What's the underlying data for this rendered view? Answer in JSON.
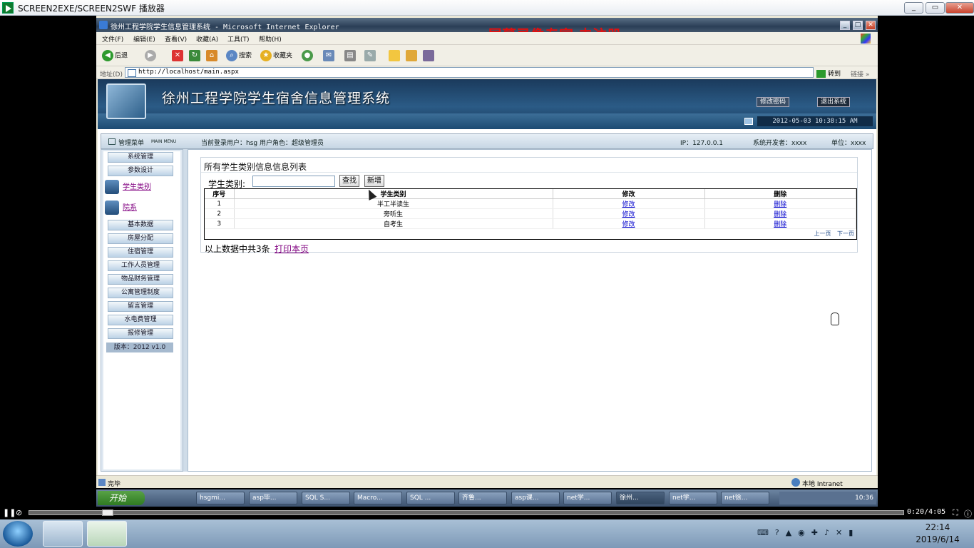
{
  "player": {
    "title": "SCREEN2EXE/SCREEN2SWF 播放器",
    "min": "_",
    "restore": "▭",
    "close": "✕",
    "time": "0:20/4:05"
  },
  "ie": {
    "title": "徐州工程学院学生信息管理系统 - Microsoft Internet Explorer",
    "watermark": "屏幕录像专家  未注册",
    "menu": [
      "文件(F)",
      "编辑(E)",
      "查看(V)",
      "收藏(A)",
      "工具(T)",
      "帮助(H)"
    ],
    "toolbar": {
      "back": "后退",
      "search": "搜索",
      "favorites": "收藏夹"
    },
    "address_label": "地址(D)",
    "address": "http://localhost/main.aspx",
    "go": "转到",
    "links": "链接 »",
    "status_left": "完毕",
    "status_right": "本地 Intranet"
  },
  "app": {
    "title": "徐州工程学院学生宿舍信息管理系统",
    "change_password": "修改密码",
    "logout": "退出系统",
    "datetime": "2012-05-03 10:38:15 AM",
    "menu_header": "管理菜单",
    "menu_header_en": "MAIN MENU",
    "current_user": "当前登录用户：hsg  用户角色：超级管理员",
    "ip": "IP：127.0.0.1",
    "developer": "系统开发者：xxxx",
    "unit": "单位：xxxx",
    "sidebar": {
      "top_buttons": [
        "系统管理",
        "参数设计"
      ],
      "links": [
        "学生类别",
        "院系"
      ],
      "buttons": [
        "基本数据",
        "房屋分配",
        "住宿管理",
        "工作人员管理",
        "物品财务管理",
        "公寓管理制度",
        "留言管理",
        "水电费管理",
        "报修管理"
      ],
      "version": "版本：2012 v1.0"
    },
    "panel": {
      "title": "所有学生类别信息信息列表",
      "filter_label": "学生类别:",
      "search_btn": "查找",
      "add_btn": "新增",
      "headers": [
        "序号",
        "学生类别",
        "修改",
        "删除"
      ],
      "rows": [
        {
          "no": "1",
          "name": "半工半读生",
          "edit": "修改",
          "del": "删除"
        },
        {
          "no": "2",
          "name": "旁听生",
          "edit": "修改",
          "del": "删除"
        },
        {
          "no": "3",
          "name": "自考生",
          "edit": "修改",
          "del": "删除"
        }
      ],
      "prev": "上一页",
      "next": "下一页",
      "summary": "以上数据中共3条",
      "print": "打印本页"
    }
  },
  "xp_taskbar": {
    "start": "开始",
    "tasks": [
      "hsgmi...",
      "asp毕...",
      "SQL S...",
      "Macro...",
      "SQL ...",
      "齐鲁...",
      "asp课...",
      "net学...",
      "徐州...",
      "net学...",
      "net徐..."
    ],
    "clock": "10:36"
  },
  "win7": {
    "time": "22:14",
    "date": "2019/6/14"
  }
}
